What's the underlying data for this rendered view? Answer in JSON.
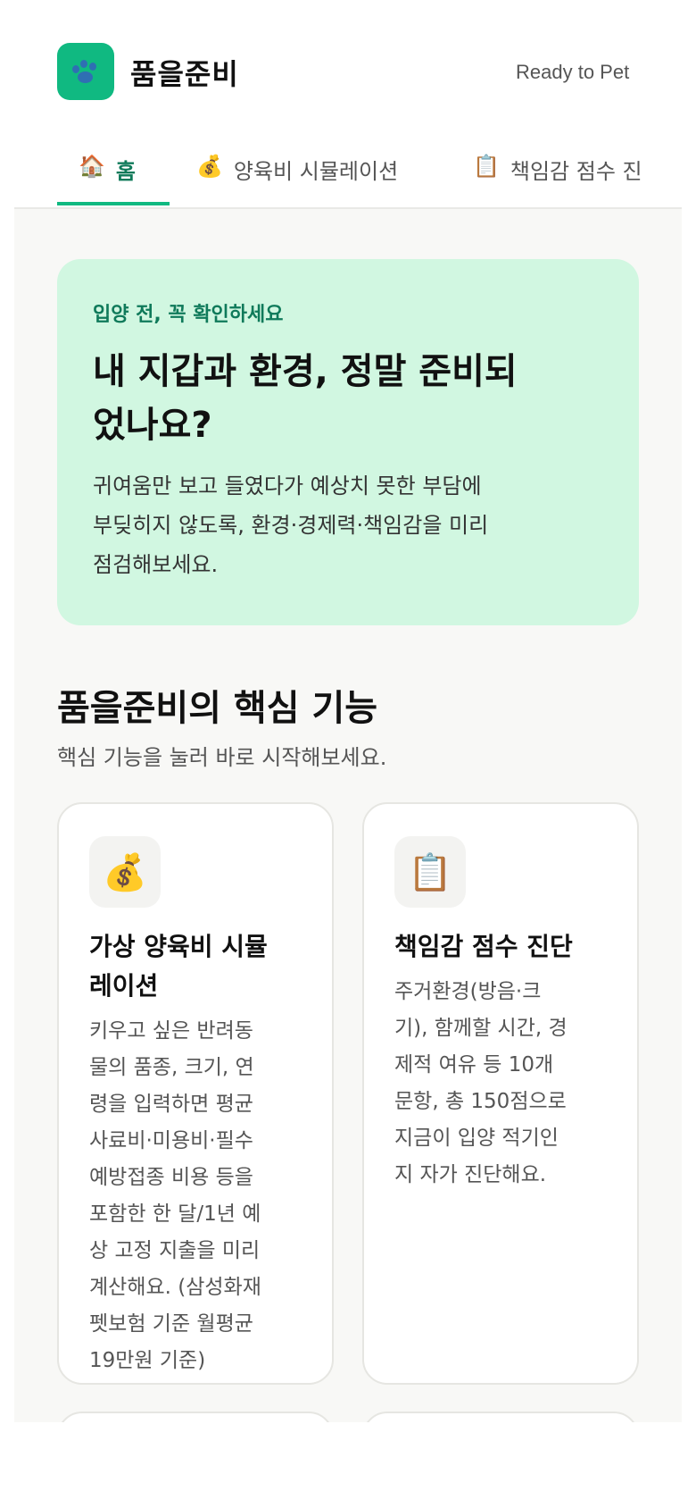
{
  "header": {
    "app_name": "품을준비",
    "tagline": "Ready to Pet",
    "logo_icon": "paw-icon",
    "brand_color": "#10b981"
  },
  "tabs": [
    {
      "icon": "🏠",
      "label": "홈",
      "active": true
    },
    {
      "icon": "💰",
      "label": "양육비 시뮬레이션",
      "active": false
    },
    {
      "icon": "📋",
      "label": "책임감 점수 진",
      "active": false
    }
  ],
  "hero": {
    "eyebrow": "입양 전, 꼭 확인하세요",
    "title_line1": "내 지갑과 환경, 정말 준비되",
    "title_line2": "었나요?",
    "desc_line1": "귀여움만 보고 들였다가 예상치 못한 부담에",
    "desc_line2": "부딪히지 않도록, 환경·경제력·책임감을 미리",
    "desc_line3": "점검해보세요."
  },
  "features": {
    "title": "품을준비의 핵심 기능",
    "subtitle": "핵심 기능을 눌러 바로 시작해보세요.",
    "cards": [
      {
        "icon": "💰",
        "title_lines": [
          "가상 양육비 시뮬",
          "레이션"
        ],
        "desc_lines": [
          "키우고 싶은 반려동",
          "물의 품종, 크기, 연",
          "령을 입력하면 평균",
          "사료비·미용비·필수",
          "예방접종 비용 등을",
          "포함한 한 달/1년 예",
          "상 고정 지출을 미리",
          "계산해요. (삼성화재",
          "펫보험 기준 월평균",
          "19만원 기준)"
        ]
      },
      {
        "icon": "📋",
        "title_lines": [
          "책임감 점수 진단"
        ],
        "desc_lines": [
          "주거환경(방음·크",
          "기), 함께할 시간, 경",
          "제적 여유 등 10개",
          "문항, 총 150점으로",
          "지금이 입양 적기인",
          "지 자가 진단해요."
        ]
      }
    ]
  }
}
